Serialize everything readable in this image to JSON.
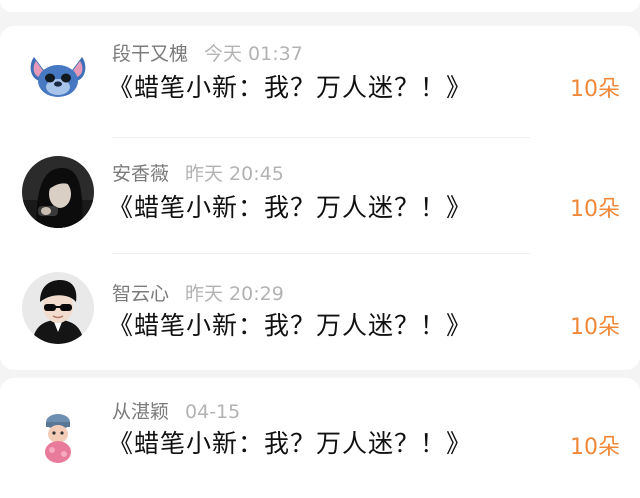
{
  "entries": [
    {
      "name": "段干又槐",
      "time": "今天 01:37",
      "title": "《蜡笔小新：我？万人迷？！》",
      "amount": "10朵",
      "avatar": "stitch-avatar"
    },
    {
      "name": "安香薇",
      "time": "昨天 20:45",
      "title": "《蜡笔小新：我？万人迷？！》",
      "amount": "10朵",
      "avatar": "dark-hair-girl-avatar"
    },
    {
      "name": "智云心",
      "time": "昨天 20:29",
      "title": "《蜡笔小新：我？万人迷？！》",
      "amount": "10朵",
      "avatar": "sunglasses-man-avatar"
    },
    {
      "name": "从湛颖",
      "time": "04-15",
      "title": "《蜡笔小新：我？万人迷？！》",
      "amount": "10朵",
      "avatar": "cartoon-doll-avatar"
    }
  ],
  "colors": {
    "amount": "#f0883a",
    "name": "#7b7b7b",
    "time": "#b3b3b3",
    "title": "#111111",
    "background": "#f4f4f4"
  }
}
